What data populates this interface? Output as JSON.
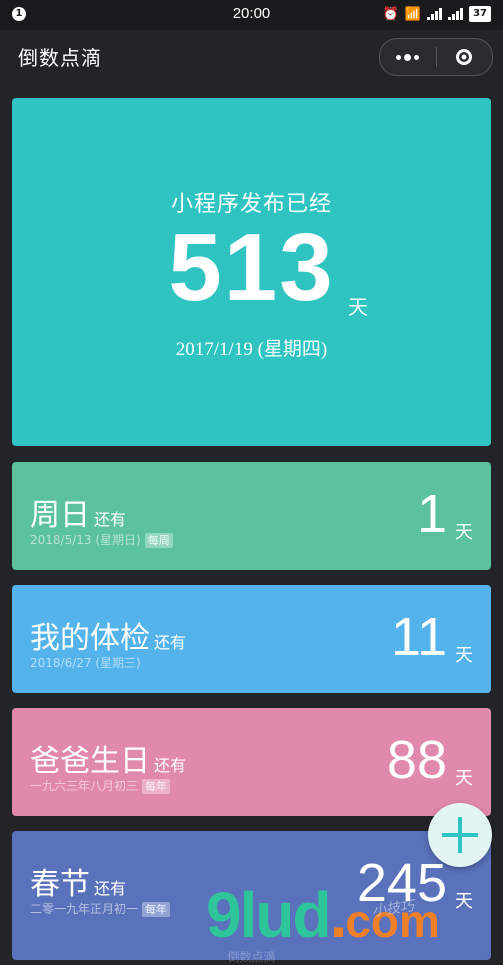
{
  "statusbar": {
    "notif": "1",
    "time": "20:00",
    "battery": "37"
  },
  "navbar": {
    "title": "倒数点滴"
  },
  "hero": {
    "label": "小程序发布已经",
    "days": "513",
    "unit": "天",
    "date": "2017/1/19 (星期四)",
    "color": "#2fc4c2"
  },
  "cards": [
    {
      "name": "周日",
      "still": "还有",
      "sub": "2018/5/13 (星期日)",
      "tag": "每周",
      "count": "1",
      "unit": "天",
      "color": "#5bc29d"
    },
    {
      "name": "我的体检",
      "still": "还有",
      "sub": "2018/6/27 (星期三)",
      "tag": "",
      "count": "11",
      "unit": "天",
      "color": "#55b3ec"
    },
    {
      "name": "爸爸生日",
      "still": "还有",
      "sub": "一九六三年八月初三",
      "tag": "每年",
      "count": "88",
      "unit": "天",
      "color": "#e188ad"
    },
    {
      "name": "春节",
      "still": "还有",
      "sub": "二零一九年正月初一",
      "tag": "每年",
      "count": "245",
      "unit": "天",
      "color": "#5a72bc"
    }
  ],
  "watermark": {
    "main": "9lud",
    "dot": ".",
    "com": "com",
    "script": "小技巧"
  },
  "footer": {
    "text": "倒数点滴"
  }
}
